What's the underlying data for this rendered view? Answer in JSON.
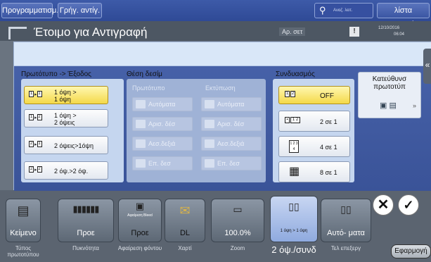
{
  "topbar": {
    "program_label": "Προγραμματισμ.",
    "quick_copy_label": "Γρήγ. αντίγ.",
    "search_text": "Αναζ. λειτ.",
    "job_list_label": "λίστα εργασιών"
  },
  "status": {
    "title": "Έτοιμο για Αντιγραφή",
    "ar_label": "Αρ. σετ",
    "date": "12/10/2016",
    "time": "06:04"
  },
  "dialog": {
    "original_output": {
      "title": "Πρωτότυπο -> Έξοδος",
      "options": [
        {
          "line1": "1 όψη >",
          "line2": "1 όψη",
          "selected": true
        },
        {
          "line1": "1 όψη >",
          "line2": "2 όψεις",
          "selected": false
        },
        {
          "line1": "2 όψεις>1όψη",
          "line2": "",
          "selected": false
        },
        {
          "line1": "2 όψ.>2 όψ.",
          "line2": "",
          "selected": false
        }
      ]
    },
    "binding_position": {
      "title": "Θέση δεσίμ",
      "original_col": "Πρωτότυπο",
      "print_col": "Εκτύπωση",
      "options": [
        "Αυτόματα",
        "Αρισ. δέσ",
        "Αεσ.δεξιά",
        "Επ. δεσ"
      ]
    },
    "combine": {
      "title": "Συνδυασμός",
      "options": [
        {
          "label": "OFF",
          "selected": true
        },
        {
          "label": "2 σε 1",
          "selected": false
        },
        {
          "label": "4 σε 1",
          "selected": false
        },
        {
          "label": "8 σε 1",
          "selected": false
        }
      ]
    },
    "original_direction": {
      "title": "Κατεύθυνσ πρωτοτύπ"
    }
  },
  "bottom": {
    "tiles": [
      {
        "label": "Κείμενο",
        "caption": "Τύπος πρωτοτύπου"
      },
      {
        "label": "Προε",
        "caption": "Πυκνότητα"
      },
      {
        "label": "Προε",
        "top_label": "Αφαίρεση Bleed",
        "caption": "Αφαίρεση φόντου"
      },
      {
        "label": "DL",
        "caption": "Χαρτί"
      },
      {
        "label": "100.0%",
        "caption": "Zoom"
      },
      {
        "label": "1 όψη > 1 όψη",
        "caption": "2 όψ./συνδ"
      },
      {
        "label": "Αυτό- ματα",
        "caption": "Τελ επεξεργ"
      }
    ],
    "apply_label": "Εφαρμογή"
  }
}
